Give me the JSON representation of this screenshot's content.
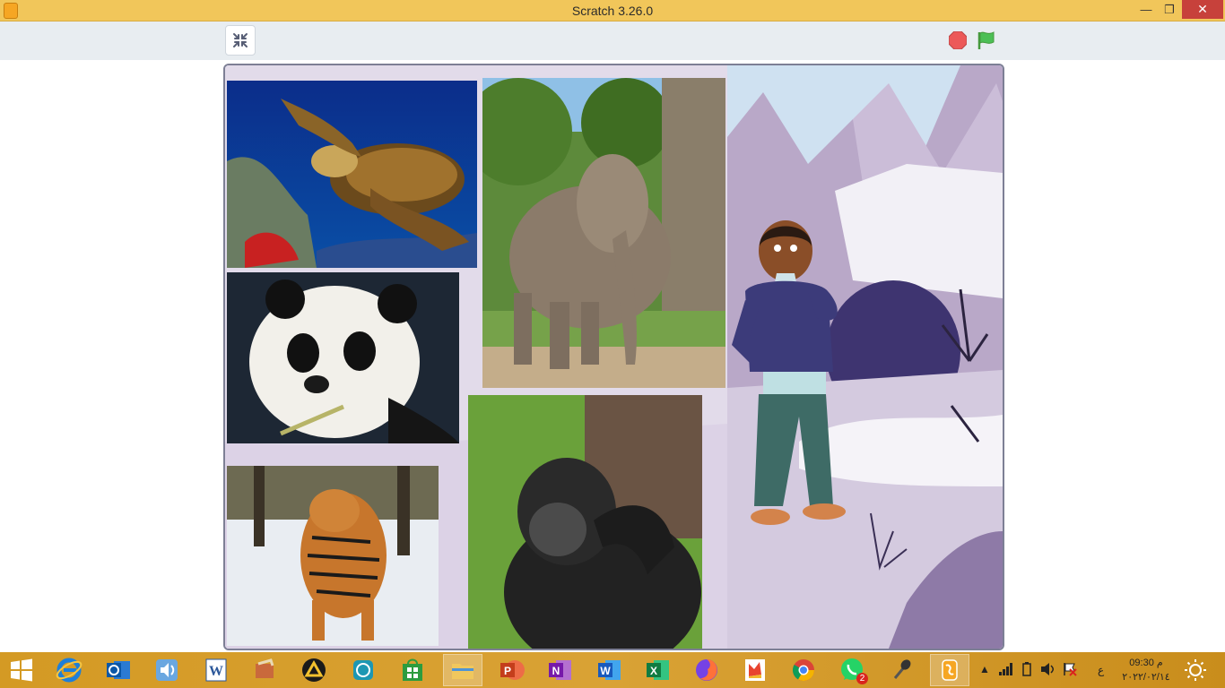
{
  "window": {
    "title": "Scratch 3.26.0",
    "min_glyph": "—",
    "max_glyph": "❐",
    "close_glyph": "✕"
  },
  "toolbar": {
    "unfullscreen_icon": "unfullscreen-icon",
    "stop_icon": "stop-icon",
    "green_flag_icon": "green-flag-icon"
  },
  "stage": {
    "backdrop": "snowy-mountain-cave",
    "sprites": [
      "turtle-photo",
      "elephant-photo",
      "panda-photo",
      "tiger-photo",
      "chimpanzee-photo",
      "boy-character"
    ]
  },
  "taskbar": {
    "apps": [
      {
        "name": "start",
        "icon": "windows-start-icon"
      },
      {
        "name": "internet-explorer",
        "icon": "internet-explorer-icon"
      },
      {
        "name": "outlook",
        "icon": "outlook-icon"
      },
      {
        "name": "speaker-app",
        "icon": "speaker-icon"
      },
      {
        "name": "word-old",
        "icon": "word-icon"
      },
      {
        "name": "paint-app",
        "icon": "paint-icon"
      },
      {
        "name": "triangle-app",
        "icon": "triangle-app-icon"
      },
      {
        "name": "cube-app",
        "icon": "cube-icon"
      },
      {
        "name": "store",
        "icon": "store-icon"
      },
      {
        "name": "file-explorer",
        "icon": "folder-icon"
      },
      {
        "name": "powerpoint",
        "icon": "powerpoint-icon"
      },
      {
        "name": "onenote",
        "icon": "onenote-icon"
      },
      {
        "name": "word",
        "icon": "word-icon"
      },
      {
        "name": "excel",
        "icon": "excel-icon"
      },
      {
        "name": "firefox",
        "icon": "firefox-icon"
      },
      {
        "name": "photo-app",
        "icon": "photo-app-icon"
      },
      {
        "name": "chrome",
        "icon": "chrome-icon"
      },
      {
        "name": "whatsapp",
        "icon": "whatsapp-icon",
        "badge": "2"
      },
      {
        "name": "microphone",
        "icon": "microphone-icon"
      },
      {
        "name": "scratch",
        "icon": "scratch-icon"
      }
    ],
    "tray": {
      "lang": "ع",
      "time": "09:30 م",
      "date": "٢٠٢٢/٠٢/١٤"
    }
  },
  "colors": {
    "titlebar": "#f1c65a",
    "toolbar": "#e8edf1",
    "stop": "#ec5959",
    "flag": "#4cbf56",
    "taskbar": "#d9a235"
  }
}
